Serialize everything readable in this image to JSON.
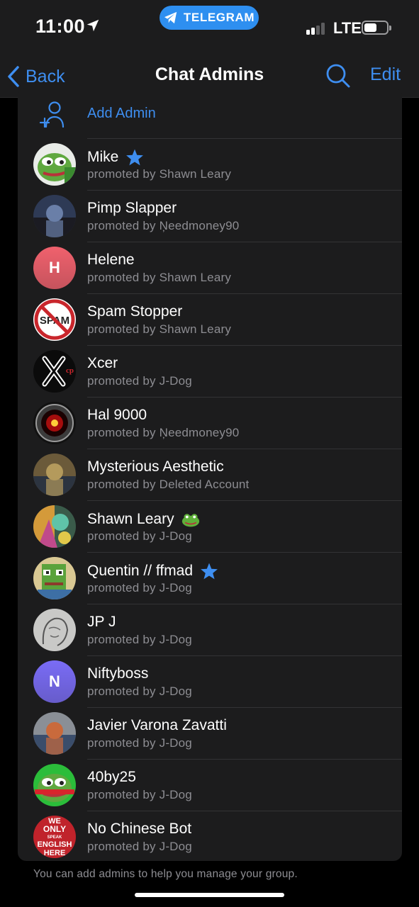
{
  "status_bar": {
    "time": "11:00",
    "pill_label": "TELEGRAM",
    "network": "LTE",
    "signal_bars": 2,
    "signal_bars_total": 4,
    "battery_level": 0.55,
    "accent_color": "#2e8ff0"
  },
  "nav": {
    "back_label": "Back",
    "title": "Chat Admins",
    "edit_label": "Edit",
    "search_icon": "search-icon"
  },
  "add_admin": {
    "label": "Add Admin",
    "icon": "add-user-icon"
  },
  "admins": [
    {
      "name": "Mike",
      "subtitle": "promoted by Shawn Leary",
      "badge": "star",
      "avatar": "pepe-frog"
    },
    {
      "name": "Pimp Slapper",
      "subtitle": "promoted by Ņeedmoney90",
      "badge": "",
      "avatar": "photo"
    },
    {
      "name": "Helene",
      "subtitle": "promoted by Shawn Leary",
      "badge": "",
      "avatar": "initial",
      "initial": "H",
      "avatar_color": "#f0616d"
    },
    {
      "name": "Spam Stopper",
      "subtitle": "promoted by Shawn Leary",
      "badge": "",
      "avatar": "no-spam-sign"
    },
    {
      "name": "Xcer",
      "subtitle": "promoted by J-Dog",
      "badge": "",
      "avatar": "x-logo"
    },
    {
      "name": "Hal 9000",
      "subtitle": "promoted by Ņeedmoney90",
      "badge": "",
      "avatar": "hal-eye"
    },
    {
      "name": "Mysterious Aesthetic",
      "subtitle": "promoted by Deleted Account",
      "badge": "",
      "avatar": "photo"
    },
    {
      "name": "Shawn Leary",
      "subtitle": "promoted by J-Dog",
      "badge": "frog",
      "avatar": "art"
    },
    {
      "name": "Quentin // ffmad",
      "subtitle": "promoted by J-Dog",
      "badge": "star",
      "avatar": "pixel-frog"
    },
    {
      "name": "JP J",
      "subtitle": "promoted by J-Dog",
      "badge": "",
      "avatar": "sketch"
    },
    {
      "name": "Niftyboss",
      "subtitle": "promoted by J-Dog",
      "badge": "",
      "avatar": "initial",
      "initial": "N",
      "avatar_color": "#7a6cf6"
    },
    {
      "name": "Javier Varona Zavatti",
      "subtitle": "promoted by J-Dog",
      "badge": "",
      "avatar": "photo"
    },
    {
      "name": "40by25",
      "subtitle": "promoted by J-Dog",
      "badge": "",
      "avatar": "pepe-frog"
    },
    {
      "name": "No Chinese Bot",
      "subtitle": "promoted by J-Dog",
      "badge": "",
      "avatar": "sign",
      "avatar_text": [
        "WE",
        "ONLY",
        "SPEAK",
        "ENGLISH",
        "HERE"
      ]
    }
  ],
  "footer": {
    "note": "You can add admins to help you manage your group."
  }
}
